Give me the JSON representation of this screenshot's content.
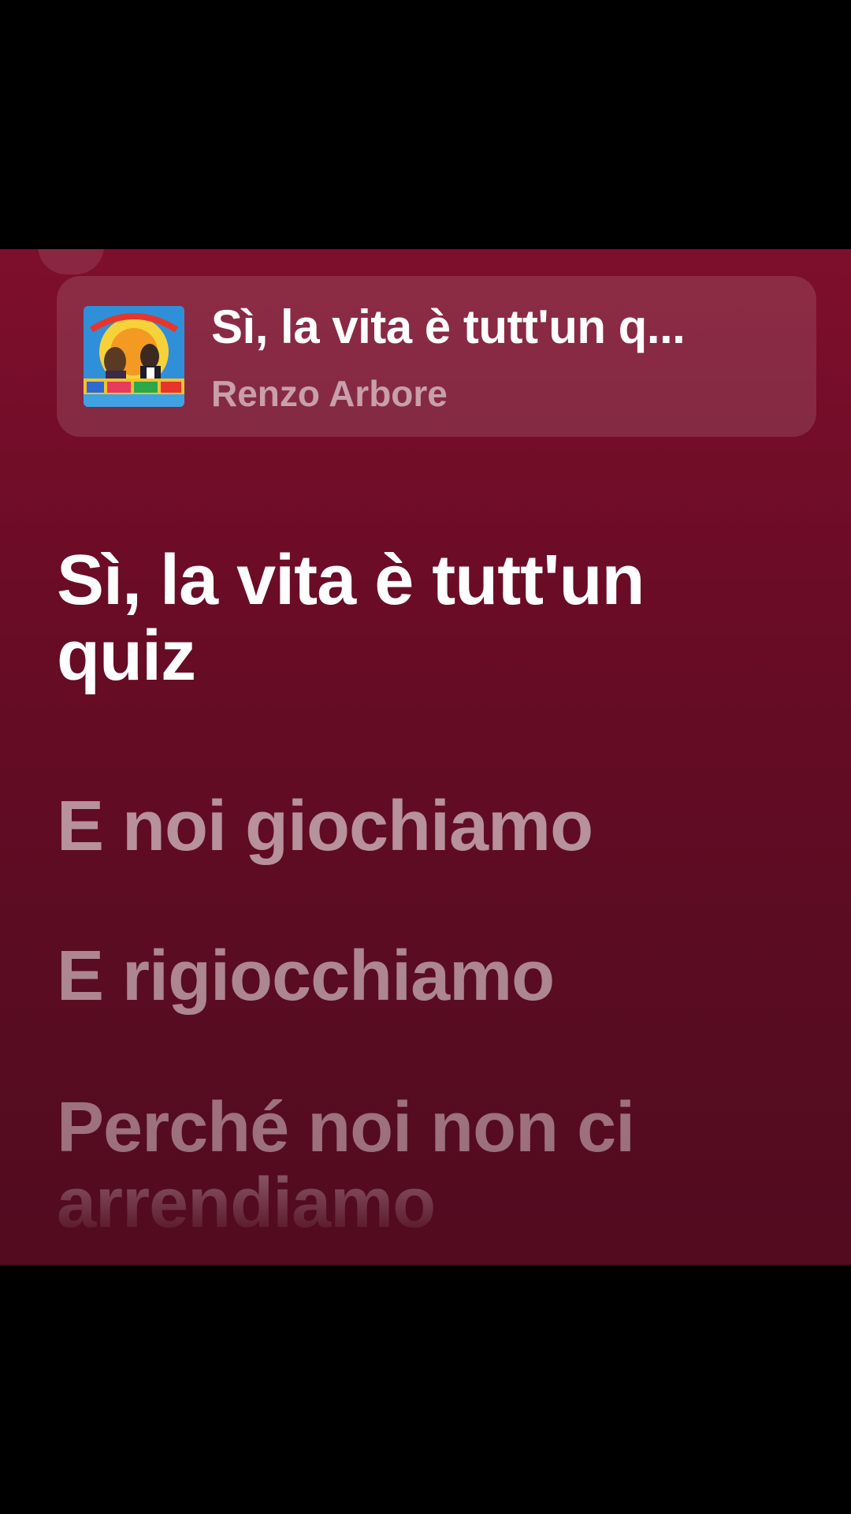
{
  "now_playing": {
    "title": "Sì, la vita è tutt'un q...",
    "artist": "Renzo Arbore",
    "album_art_icon": "album-cover-image"
  },
  "lyrics": {
    "active_line": "Sì, la vita è tutt'un quiz",
    "upcoming_lines": [
      "E noi giochiamo",
      "E rigiocchiamo",
      "Perché noi non ci arrendiamo"
    ]
  },
  "colors": {
    "background_top": "#7e0e2c",
    "background_bottom": "#520b1f",
    "active_text": "#ffffff"
  }
}
